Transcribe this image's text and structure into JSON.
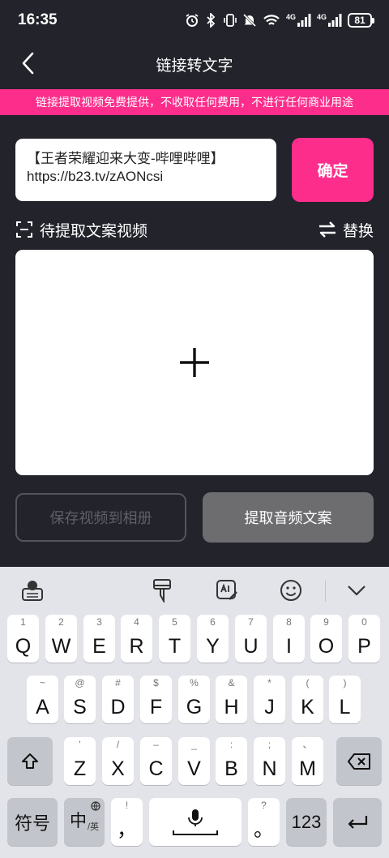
{
  "status_bar": {
    "time": "16:35",
    "signal_label_1": "4G",
    "signal_label_2": "4G",
    "battery": "81"
  },
  "nav": {
    "title": "链接转文字"
  },
  "banner": {
    "text": "链接提取视频免费提供，不收取任何费用，不进行任何商业用途"
  },
  "link_input": {
    "line1": "【王者荣耀迎来大变-哔哩哔哩】",
    "line2": "https://b23.tv/zAONcsi"
  },
  "confirm_label": "确定",
  "section": {
    "label": "待提取文案视频",
    "swap_label": "替换"
  },
  "buttons": {
    "save_video": "保存视频到相册",
    "extract_audio": "提取音频文案"
  },
  "keyboard": {
    "row1": [
      {
        "main": "Q",
        "hint": "1"
      },
      {
        "main": "W",
        "hint": "2"
      },
      {
        "main": "E",
        "hint": "3"
      },
      {
        "main": "R",
        "hint": "4"
      },
      {
        "main": "T",
        "hint": "5"
      },
      {
        "main": "Y",
        "hint": "6"
      },
      {
        "main": "U",
        "hint": "7"
      },
      {
        "main": "I",
        "hint": "8"
      },
      {
        "main": "O",
        "hint": "9"
      },
      {
        "main": "P",
        "hint": "0"
      }
    ],
    "row2": [
      {
        "main": "A",
        "hint": "~"
      },
      {
        "main": "S",
        "hint": "@"
      },
      {
        "main": "D",
        "hint": "#"
      },
      {
        "main": "F",
        "hint": "$"
      },
      {
        "main": "G",
        "hint": "%"
      },
      {
        "main": "H",
        "hint": "&"
      },
      {
        "main": "J",
        "hint": "*"
      },
      {
        "main": "K",
        "hint": "("
      },
      {
        "main": "L",
        "hint": ")"
      }
    ],
    "row3": [
      {
        "main": "Z",
        "hint": "'"
      },
      {
        "main": "X",
        "hint": "/"
      },
      {
        "main": "C",
        "hint": "–"
      },
      {
        "main": "V",
        "hint": "_"
      },
      {
        "main": "B",
        "hint": ":"
      },
      {
        "main": "N",
        "hint": ";"
      },
      {
        "main": "M",
        "hint": "、"
      }
    ],
    "symbols_label": "符号",
    "lang_main": "中",
    "lang_sub": "/英",
    "comma_main": "，",
    "comma_hint": "!",
    "period_main": "。",
    "period_hint": "?",
    "num_label": "123"
  }
}
